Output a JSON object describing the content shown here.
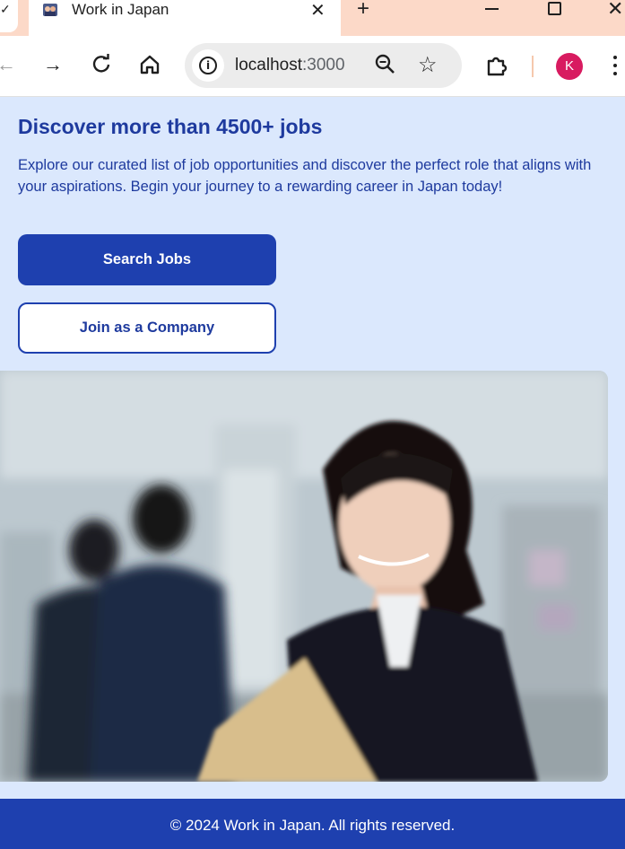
{
  "browser": {
    "tab_title": "Work in Japan",
    "url_host": "localhost",
    "url_port": ":3000",
    "profile_initial": "K"
  },
  "hero": {
    "title": "Discover more than 4500+ jobs",
    "description": "Explore our curated list of job opportunities and discover the perfect role that aligns with your aspirations. Begin your journey to a rewarding career in Japan today!",
    "primary_button": "Search Jobs",
    "secondary_button": "Join as a Company"
  },
  "footer": {
    "copyright": "© 2024 Work in Japan. All rights reserved."
  },
  "colors": {
    "brand": "#1e40af",
    "page_bg": "#dbe8fd",
    "tabbar_bg": "#fcd9c8",
    "avatar": "#d81b60"
  }
}
